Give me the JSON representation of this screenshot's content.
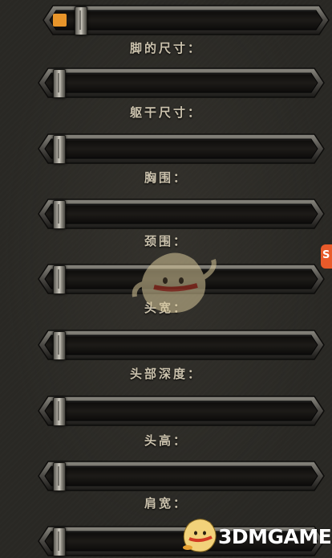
{
  "labels": {
    "foot_size": "脚的尺寸：",
    "torso_size": "躯干尺寸：",
    "chest": "胸围：",
    "neck": "颈围：",
    "head_width": "头宽：",
    "head_depth": "头部深度：",
    "head_height": "头高：",
    "shoulder_width": "肩宽："
  },
  "sliders": [
    {
      "name": "top-partial",
      "value": 0.04
    },
    {
      "name": "foot-size",
      "value": 0.0
    },
    {
      "name": "torso-size",
      "value": 0.0
    },
    {
      "name": "chest",
      "value": 0.0
    },
    {
      "name": "neck",
      "value": 0.0
    },
    {
      "name": "head-width",
      "value": 0.0
    },
    {
      "name": "head-depth",
      "value": 0.0
    },
    {
      "name": "head-height",
      "value": 0.0
    },
    {
      "name": "shoulder-width",
      "value": 0.0
    }
  ],
  "watermark": {
    "logo_text": "3DMGAME",
    "badge_text": "S"
  },
  "colors": {
    "fill": "#e8952a",
    "background": "#2a2925",
    "label": "#cbc2ad"
  }
}
